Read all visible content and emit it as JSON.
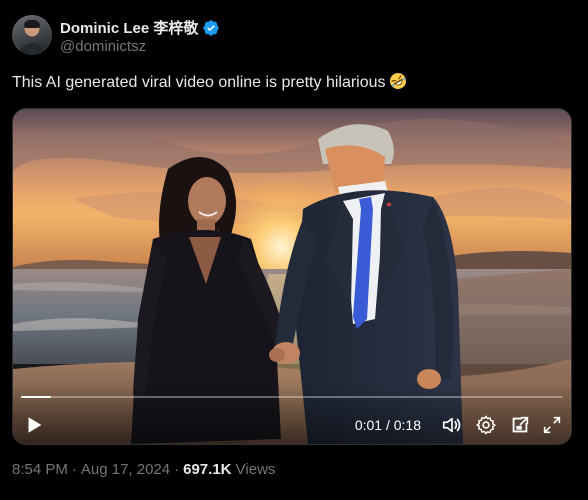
{
  "author": {
    "display_name": "Dominic Lee 李梓敬",
    "handle": "@dominictsz",
    "verified": true
  },
  "tweet": {
    "text": "This AI generated viral video online is pretty hilarious",
    "emoji": "rolling-on-floor-laughing-emoji"
  },
  "media": {
    "type": "video",
    "time_current": "0:01",
    "time_total": "0:18",
    "time_display": "0:01 / 0:18",
    "progress_fraction": 0.055,
    "scene": "beach-sunset-couple-holding-hands"
  },
  "meta": {
    "time": "8:54 PM",
    "separator": "·",
    "date": "Aug 17, 2024",
    "views_count": "697.1K",
    "views_label": "Views"
  },
  "icons": {
    "verified": "verified-badge-icon",
    "play": "play-icon",
    "volume": "volume-icon",
    "settings": "gear-icon",
    "pip": "picture-in-picture-icon",
    "fullscreen": "fullscreen-icon"
  },
  "colors": {
    "background": "#000000",
    "text_primary": "#e7e9ea",
    "text_secondary": "#71767b",
    "verified_blue": "#1d9bf0",
    "border": "#2f3336"
  }
}
